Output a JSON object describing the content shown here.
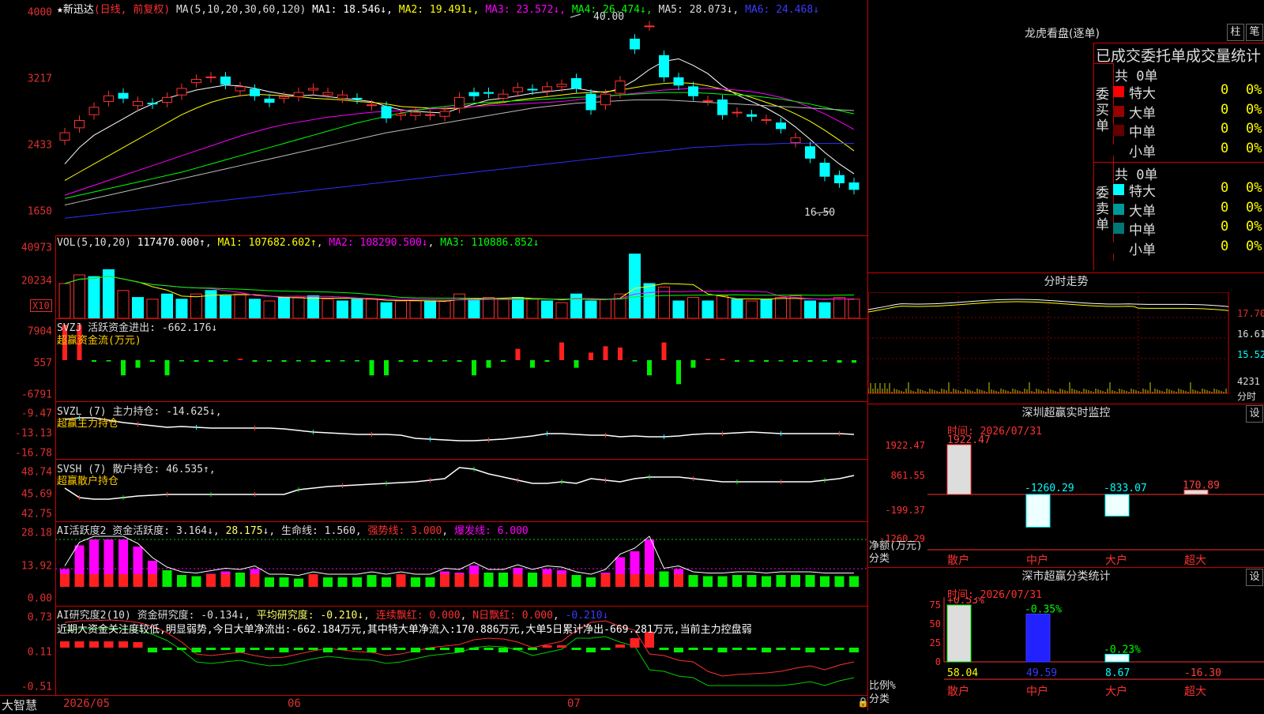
{
  "stock": {
    "name": "新迅达",
    "period": "(日线, 前复权)"
  },
  "ma_legend": [
    {
      "label": "MA(5,10,20,30,60,120)",
      "color": "#dddddd"
    },
    {
      "label": "MA1: 18.546↓",
      "color": "#ffffff"
    },
    {
      "label": "MA2: 19.491↓",
      "color": "#ffff00"
    },
    {
      "label": "MA3: 23.572↓",
      "color": "#ff00ff"
    },
    {
      "label": "MA4: 26.474↓",
      "color": "#00ff00"
    },
    {
      "label": "MA5: 28.073↓",
      "color": "#dddddd"
    },
    {
      "label": "MA6: 24.468↓",
      "color": "#3a3aff"
    }
  ],
  "price_axis": [
    "4000",
    "3217",
    "2433",
    "1650"
  ],
  "price_annotations": {
    "high": "40.00",
    "low": "16.50"
  },
  "vol": {
    "title": "VOL(5,10,20)",
    "value": "117470.000↑",
    "ma1": "MA1: 107682.602↑",
    "ma2": "MA2: 108290.500↓",
    "ma3": "MA3: 110886.852↓",
    "axis": [
      "40973",
      "20234"
    ],
    "unit": "X10"
  },
  "svzj": {
    "title": "SVZJ  活跃资金进出: -662.176↓",
    "subtitle": "超赢资金流(万元)",
    "axis": [
      "7904",
      "557",
      "-6791"
    ]
  },
  "svzl": {
    "title": "SVZL (7) 主力持仓: -14.625↓,",
    "subtitle": "超赢主力持仓",
    "axis": [
      "-9.47",
      "-13.13",
      "-16.78"
    ]
  },
  "svsh": {
    "title": "SVSH (7) 散户持仓: 46.535↑,",
    "subtitle": "超赢散户持仓",
    "axis": [
      "48.74",
      "45.69",
      "42.75"
    ]
  },
  "ai2": {
    "title": "AI活跃度2 资金活跃度: 3.164↓",
    "v2": "28.175",
    "life": "生命线: 1.560",
    "strong": "强势线: 3.000",
    "burst": "爆发线: 6.000",
    "axis": [
      "28.18",
      "13.92",
      "0.00"
    ]
  },
  "ai_research": {
    "title": "AI研究度2(10) 资金研究度: -0.134↓",
    "avg": "平均研究度: -0.210↓",
    "red": "连续飘红: 0.000",
    "nred": "N日飘红: 0.000",
    "last": "-0.210↓",
    "note": "近期大资金关注度较低,明显弱势,今日大单净流出:-662.184万元,其中特大单净流入:170.886万元,大单5日累计净出-669.281万元,当前主力控盘弱",
    "axis": [
      "0.73",
      "0.11",
      "-0.51"
    ]
  },
  "date_axis": [
    "2026/05",
    "06",
    "07"
  ],
  "brand": "大智慧",
  "longhu": {
    "title": "龙虎看盘(逐单)",
    "btn1": "柱",
    "btn2": "笔",
    "tabs": "已成交委托单成交量统计",
    "buy_label": "委买单",
    "sell_label": "委卖单",
    "buy_total": "共 0单",
    "sell_total": "共 0单",
    "buy_rows": [
      {
        "name": "特大",
        "count": "0",
        "pct": "0%",
        "color": "#ff0000"
      },
      {
        "name": "大单",
        "count": "0",
        "pct": "0%",
        "color": "#990000"
      },
      {
        "name": "中单",
        "count": "0",
        "pct": "0%",
        "color": "#660000"
      },
      {
        "name": "小单",
        "count": "0",
        "pct": "0%",
        "color": "#000000"
      }
    ],
    "sell_rows": [
      {
        "name": "特大",
        "count": "0",
        "pct": "0%",
        "color": "#00ffff"
      },
      {
        "name": "大单",
        "count": "0",
        "pct": "0%",
        "color": "#009999"
      },
      {
        "name": "中单",
        "count": "0",
        "pct": "0%",
        "color": "#007777"
      },
      {
        "name": "小单",
        "count": "0",
        "pct": "0%",
        "color": "#000000"
      }
    ]
  },
  "intraday": {
    "title": "分时走势",
    "axis": [
      "17.70",
      "16.61",
      "15.52"
    ],
    "vol_label": "4231",
    "vol_unit": "分时"
  },
  "monitor": {
    "title": "深圳超赢实时监控",
    "settings": "设",
    "time": "时间: 2026/07/31",
    "axis": [
      "1922.47",
      "861.55",
      "-199.37",
      "-1260.29"
    ],
    "ylabel": "净额(万元)",
    "xlabel": "分类",
    "categories": [
      "散户",
      "中户",
      "大户",
      "超大"
    ],
    "values": [
      "1922.47",
      "-1260.29",
      "-833.07",
      "170.89"
    ],
    "value_colors": [
      "#ff4040",
      "#00ffff",
      "#00ffff",
      "#ff4040"
    ]
  },
  "classify": {
    "title": "深市超赢分类统计",
    "settings": "设",
    "time": "时间: 2026/07/31",
    "axis": [
      "75",
      "50",
      "25",
      "0"
    ],
    "ylabel": "比例%",
    "xlabel": "分类",
    "categories": [
      "散户",
      "中户",
      "大户",
      "超大"
    ],
    "bottom_values": [
      "58.04",
      "49.59",
      "8.67",
      "-16.30"
    ],
    "top_labels": [
      "+0.53%",
      "-0.35%",
      "-0.23%"
    ],
    "top_colors": [
      "#ff4040",
      "#00ff00",
      "#00ff00"
    ],
    "bottom_colors": [
      "#ffff00",
      "#3a3aff",
      "#00ffff",
      "#ff4040"
    ]
  }
}
